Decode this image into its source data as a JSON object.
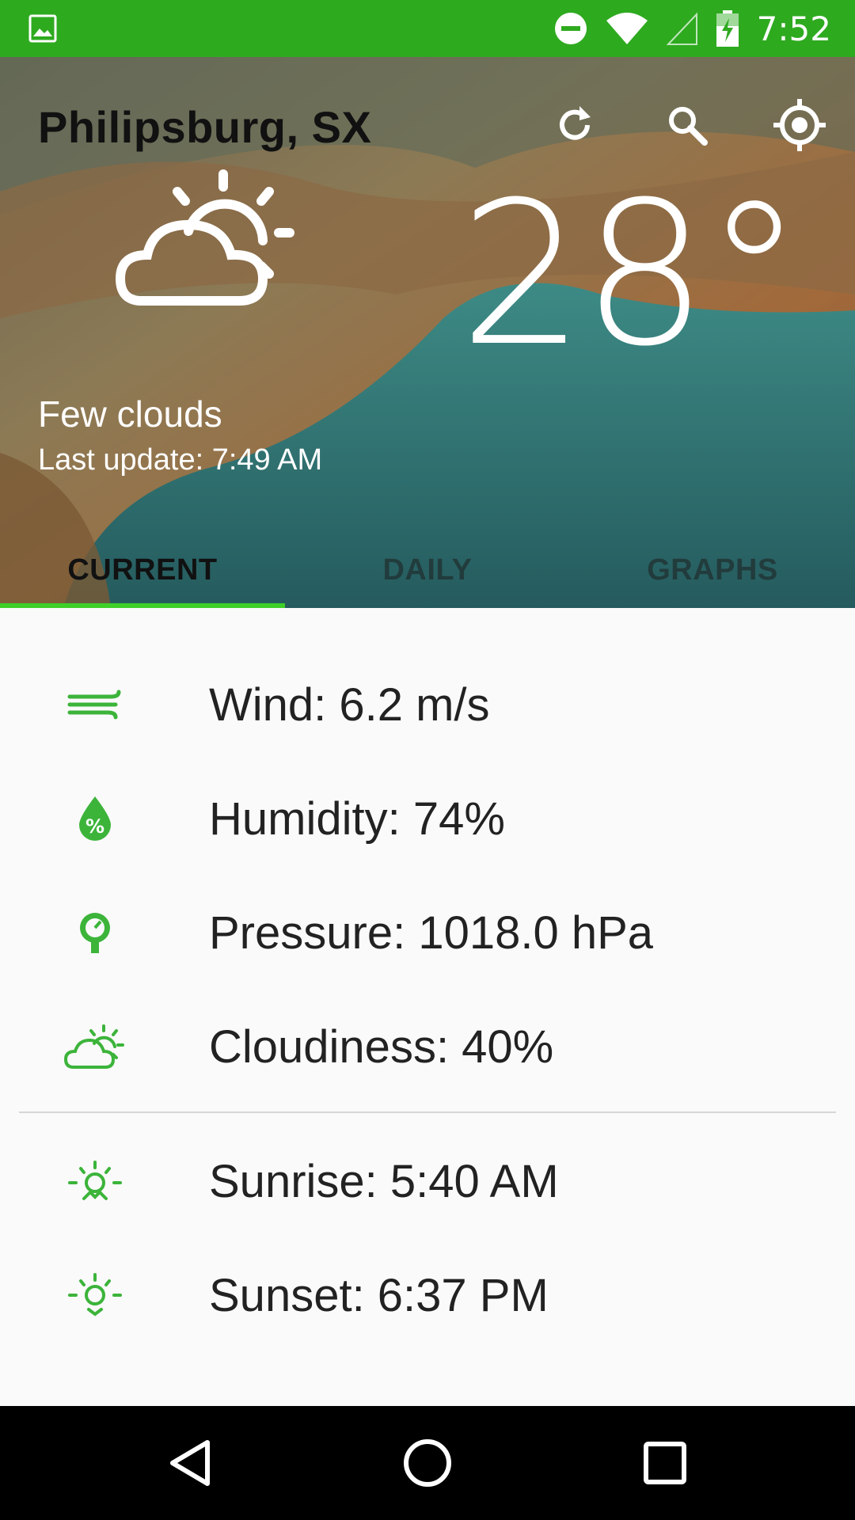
{
  "status_bar": {
    "time": "7:52",
    "icons": [
      "image-notification-icon",
      "do-not-disturb-icon",
      "wifi-icon",
      "signal-icon",
      "battery-charging-icon"
    ]
  },
  "header": {
    "city": "Philipsburg, SX",
    "temperature": "28°",
    "description": "Few clouds",
    "last_update": "Last update: 7:49 AM",
    "actions": [
      "refresh-icon",
      "search-icon",
      "location-icon"
    ]
  },
  "tabs": [
    {
      "label": "CURRENT",
      "active": true
    },
    {
      "label": "DAILY",
      "active": false
    },
    {
      "label": "GRAPHS",
      "active": false
    }
  ],
  "details": {
    "wind": "Wind: 6.2 m/s",
    "humidity": "Humidity: 74%",
    "pressure": "Pressure: 1018.0 hPa",
    "cloudiness": "Cloudiness: 40%",
    "sunrise": "Sunrise: 5:40 AM",
    "sunset": "Sunset: 6:37 PM"
  },
  "colors": {
    "accent": "#2eaa1f",
    "icon_green": "#3cb43a",
    "tab_indicator": "#3ecf29",
    "navbar": "#000000"
  }
}
